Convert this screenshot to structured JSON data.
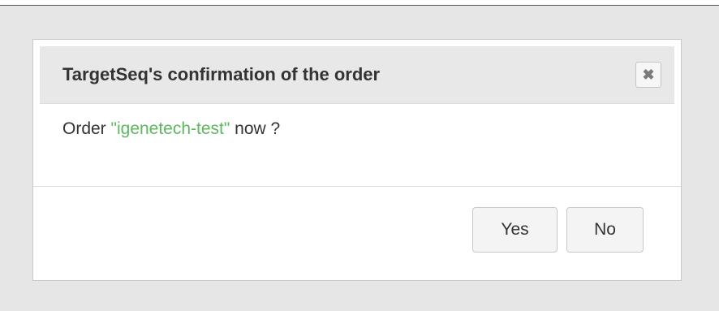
{
  "dialog": {
    "title": "TargetSeq's confirmation of the order",
    "close_icon": "close-icon",
    "close_glyph": "✖",
    "message": {
      "prefix": "Order ",
      "order_name": "\"igenetech-test\"",
      "suffix": " now ?"
    },
    "buttons": {
      "yes_label": "Yes",
      "no_label": "No"
    }
  },
  "colors": {
    "order_name": "#5cb85c",
    "background": "#e6e6e6",
    "header_background": "#e8e8e8"
  }
}
